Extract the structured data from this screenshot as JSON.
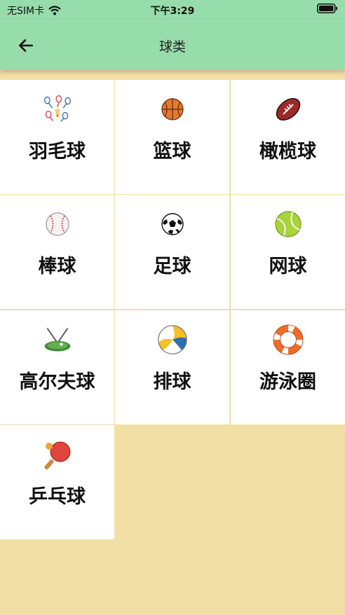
{
  "status_bar": {
    "carrier": "无SIM卡",
    "time": "下午3:29"
  },
  "app_bar": {
    "title": "球类"
  },
  "items": [
    {
      "label": "羽毛球",
      "icon": "badminton-icon"
    },
    {
      "label": "篮球",
      "icon": "basketball-icon"
    },
    {
      "label": "橄榄球",
      "icon": "rugby-ball-icon"
    },
    {
      "label": "棒球",
      "icon": "baseball-icon"
    },
    {
      "label": "足球",
      "icon": "soccer-ball-icon"
    },
    {
      "label": "网球",
      "icon": "tennis-ball-icon"
    },
    {
      "label": "高尔夫球",
      "icon": "golf-icon"
    },
    {
      "label": "排球",
      "icon": "volleyball-icon"
    },
    {
      "label": "游泳圈",
      "icon": "swim-ring-icon"
    },
    {
      "label": "乒乓球",
      "icon": "ping-pong-icon"
    }
  ],
  "colors": {
    "app_bar": "#97dcab",
    "background": "#f1dfa6",
    "cell": "#ffffff"
  }
}
